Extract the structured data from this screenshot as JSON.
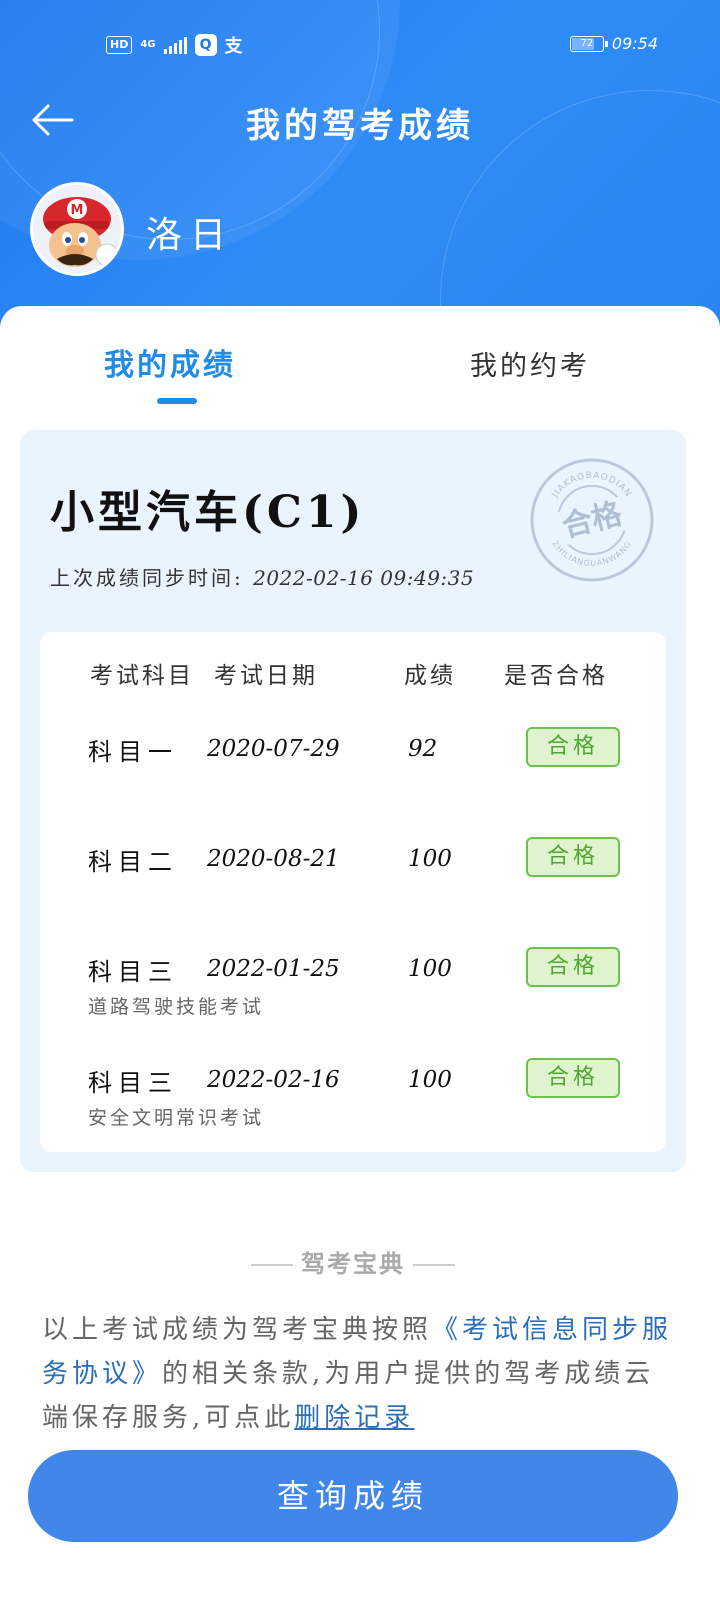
{
  "status_bar": {
    "hd": "HD",
    "network": "4G",
    "app_icon": "Q",
    "alipay_glyph": "支",
    "battery": "72",
    "time": "09:54"
  },
  "header": {
    "title": "我的驾考成绩",
    "back_icon": "arrow-left-icon",
    "username": "洛日",
    "avatar_icon": "mario-avatar"
  },
  "tabs": [
    {
      "label": "我的成绩",
      "active": true
    },
    {
      "label": "我的约考",
      "active": false
    }
  ],
  "card": {
    "car_type": "小型汽车(C1)",
    "sync_label": "上次成绩同步时间:",
    "sync_time": "2022-02-16 09:49:35",
    "stamp": {
      "center_text": "合格",
      "top_text": "JIAKAOBAODIAN",
      "bottom_text": "ZHILIANGUANWANG"
    }
  },
  "table": {
    "headers": [
      "考试科目",
      "考试日期",
      "成绩",
      "是否合格"
    ],
    "rows": [
      {
        "subject": "科目一",
        "date": "2020-07-29",
        "score": "92",
        "result": "合格",
        "note": ""
      },
      {
        "subject": "科目二",
        "date": "2020-08-21",
        "score": "100",
        "result": "合格",
        "note": ""
      },
      {
        "subject": "科目三",
        "date": "2022-01-25",
        "score": "100",
        "result": "合格",
        "note": "道路驾驶技能考试"
      },
      {
        "subject": "科目三",
        "date": "2022-02-16",
        "score": "100",
        "result": "合格",
        "note": "安全文明常识考试"
      }
    ]
  },
  "footer": {
    "brand": "驾考宝典",
    "disclaimer_pre": "以上考试成绩为驾考宝典按照",
    "disclaimer_link": "《考试信息同步服务协议》",
    "disclaimer_mid": "的相关条款,为用户提供的驾考成绩云端保存服务,可点此",
    "delete_link": "删除记录",
    "query_button": "查询成绩"
  },
  "colors": {
    "header_blue": "#1e78f0",
    "tab_active": "#1f8de8",
    "pass_green": "#6cc24a",
    "button_blue": "#4187ea"
  }
}
